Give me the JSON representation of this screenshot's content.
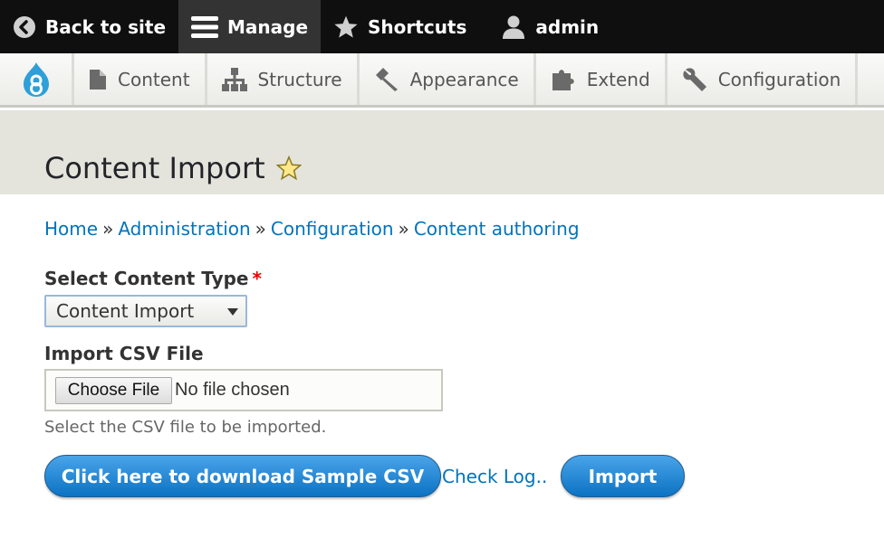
{
  "toolbar": {
    "back_label": "Back to site",
    "manage_label": "Manage",
    "shortcuts_label": "Shortcuts",
    "user_label": "admin"
  },
  "tray": {
    "items": [
      {
        "label": "Content",
        "icon": "file-icon"
      },
      {
        "label": "Structure",
        "icon": "structure-icon"
      },
      {
        "label": "Appearance",
        "icon": "hammer-icon"
      },
      {
        "label": "Extend",
        "icon": "puzzle-icon"
      },
      {
        "label": "Configuration",
        "icon": "wrench-icon"
      }
    ]
  },
  "page": {
    "title": "Content Import"
  },
  "breadcrumb": {
    "items": [
      "Home",
      "Administration",
      "Configuration",
      "Content authoring"
    ],
    "separator": "»"
  },
  "form": {
    "content_type_label": "Select Content Type",
    "required_marker": "*",
    "content_type_value": "Content Import",
    "file_label": "Import CSV File",
    "file_button": "Choose File",
    "file_status": "No file chosen",
    "file_help": "Select the CSV file to be imported.",
    "sample_button": "Click here to download Sample CSV",
    "log_link": "Check Log..",
    "import_button": "Import"
  },
  "colors": {
    "toolbar_bg": "#0f0f0f",
    "link": "#0074bd",
    "button_blue": "#0b72c3",
    "header_bg": "#e4e4dc"
  }
}
